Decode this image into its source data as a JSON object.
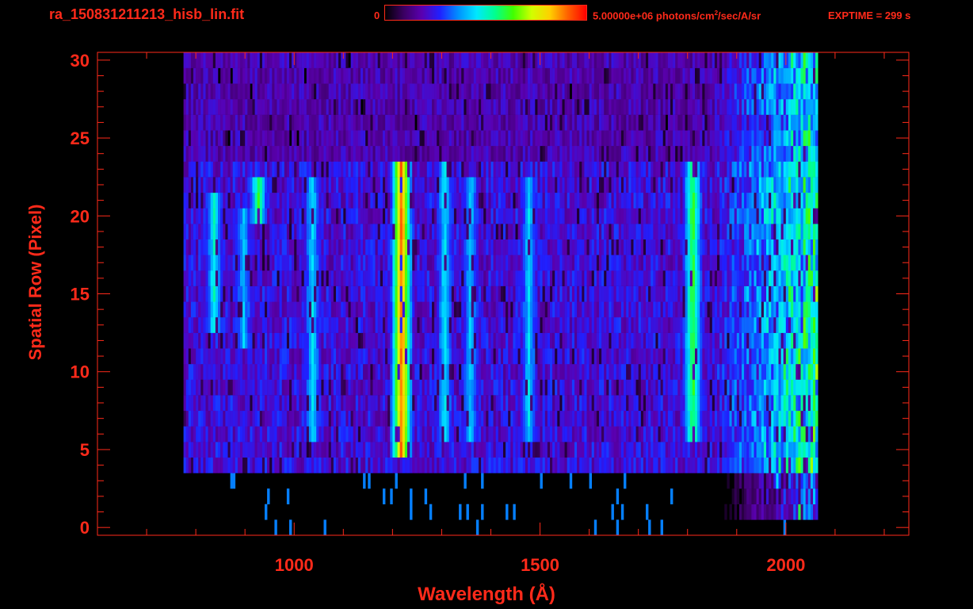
{
  "header": {
    "filename": "ra_150831211213_hisb_lin.fit",
    "colorbar_min": "0",
    "colorbar_max_prefix": "5.00000e+06 photons/cm",
    "colorbar_max_sup": "2",
    "colorbar_max_suffix": "/sec/A/sr",
    "exptime": "EXPTIME = 299 s"
  },
  "colors": {
    "axis": "#ff2a1a",
    "background": "#000000",
    "colormap": [
      "#000000",
      "#3a0060",
      "#5a00b0",
      "#2020ff",
      "#0090ff",
      "#00e8ff",
      "#00ff90",
      "#40ff00",
      "#d0ff00",
      "#ffd000",
      "#ff6000",
      "#ff0000"
    ]
  },
  "chart_data": {
    "type": "heatmap",
    "title": "",
    "xlabel": "Wavelength (Å)",
    "ylabel": "Spatial Row (Pixel)",
    "xlim": [
      600,
      2250
    ],
    "ylim": [
      -0.5,
      30.5
    ],
    "xticks": [
      1000,
      1500,
      2000
    ],
    "yticks": [
      0,
      5,
      10,
      15,
      20,
      25,
      30
    ],
    "x_minor_step": 100,
    "y_minor_step": 1,
    "colorbar_range": [
      0,
      5000000
    ],
    "data_extent": {
      "x_min": 775,
      "x_max": 2065,
      "row_min": 0,
      "row_max": 30
    },
    "emission_features": [
      {
        "wavelength": 1216,
        "rows": [
          5,
          23
        ],
        "intensity": 0.88
      },
      {
        "wavelength": 1304,
        "rows": [
          6,
          23
        ],
        "intensity": 0.42
      },
      {
        "wavelength": 1356,
        "rows": [
          6,
          22
        ],
        "intensity": 0.38
      },
      {
        "wavelength": 1475,
        "rows": [
          6,
          22
        ],
        "intensity": 0.4
      },
      {
        "wavelength": 1808,
        "rows": [
          6,
          23
        ],
        "intensity": 0.58
      },
      {
        "wavelength": 1035,
        "rows": [
          6,
          22
        ],
        "intensity": 0.4
      },
      {
        "wavelength": 925,
        "rows": [
          20,
          22
        ],
        "intensity": 0.55
      },
      {
        "wavelength": 835,
        "rows": [
          13,
          21
        ],
        "intensity": 0.45
      },
      {
        "wavelength": 895,
        "rows": [
          12,
          20
        ],
        "intensity": 0.38
      }
    ]
  }
}
